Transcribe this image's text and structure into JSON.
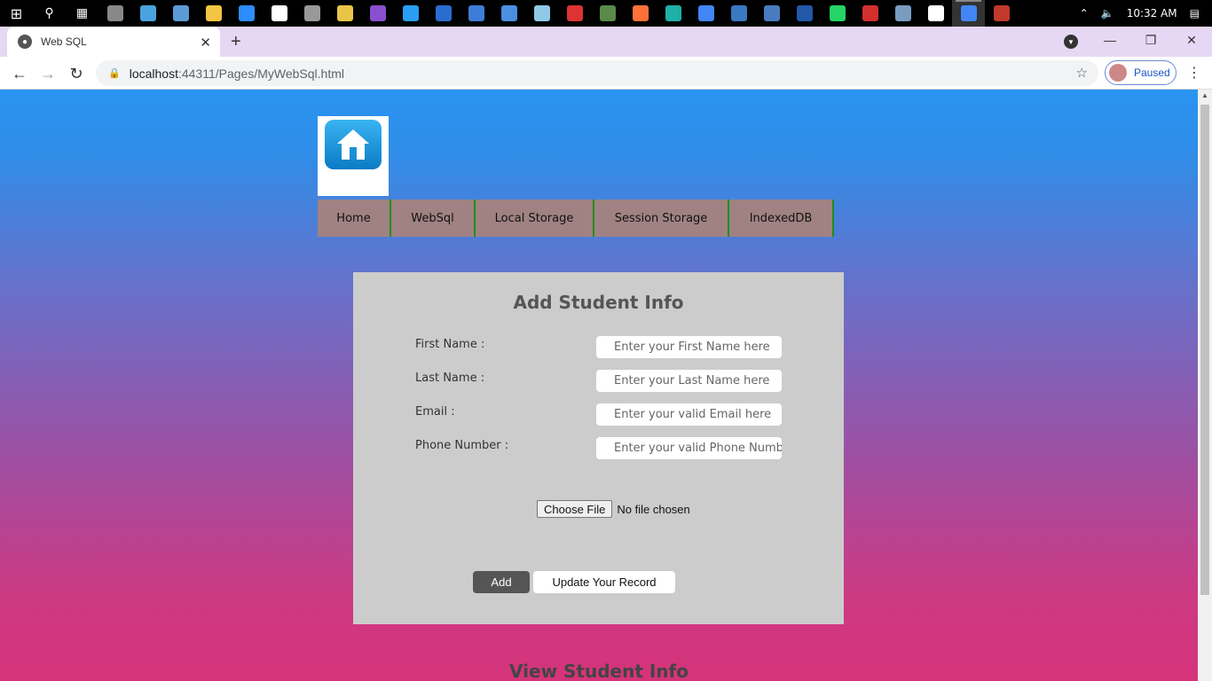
{
  "taskbar": {
    "icons": [
      "windows-icon",
      "search-icon",
      "task-view-icon",
      "calculator-icon",
      "monitor-icon",
      "contact-icon",
      "folder-icon",
      "zoom-icon",
      "app-icon",
      "usb-icon",
      "sticky-icon",
      "visual-studio-icon",
      "vscode-icon",
      "app-icon-2",
      "app-icon-3",
      "keyboard-icon",
      "notepad-icon",
      "git-icon",
      "app-icon-4",
      "firefox-icon",
      "edge-icon",
      "chrome-icon",
      "photos-icon",
      "image-icon",
      "imo-icon",
      "whatsapp-icon",
      "pdf-icon",
      "network-icon",
      "settings-icon",
      "chrome-active-icon",
      "app-icon-5"
    ],
    "time": "10:32 AM"
  },
  "browser": {
    "tab_title": "Web SQL",
    "url_host": "localhost",
    "url_rest": ":44311/Pages/MyWebSql.html",
    "profile_status": "Paused"
  },
  "nav": {
    "items": [
      {
        "label": "Home",
        "width": 83
      },
      {
        "label": "WebSql",
        "width": 95
      },
      {
        "label": "Local Storage",
        "width": 134
      },
      {
        "label": "Session Storage",
        "width": 152
      },
      {
        "label": "IndexedDB",
        "width": 118
      }
    ]
  },
  "form": {
    "title": "Add Student Info",
    "fields": [
      {
        "label": "First Name :",
        "placeholder": "Enter your First Name here"
      },
      {
        "label": "Last Name :",
        "placeholder": "Enter your Last Name here"
      },
      {
        "label": "Email :",
        "placeholder": "Enter your valid Email here"
      },
      {
        "label": "Phone Number :",
        "placeholder": "Enter your valid Phone Number here"
      }
    ],
    "file_button": "Choose File",
    "file_status": "No file chosen",
    "add_label": "Add",
    "update_label": "Update Your Record"
  },
  "view": {
    "title": "View Student Info"
  }
}
